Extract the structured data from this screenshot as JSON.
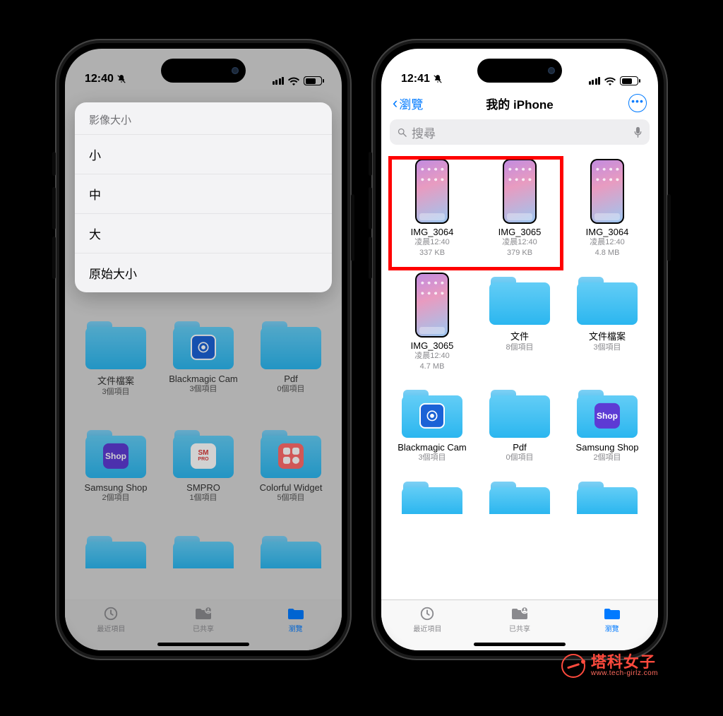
{
  "left": {
    "status": {
      "time": "12:40",
      "mute": true
    },
    "sheet": {
      "title": "影像大小",
      "options": [
        "小",
        "中",
        "大",
        "原始大小"
      ]
    },
    "grid": [
      {
        "type": "folder",
        "icon": "plain",
        "name": "文件檔案",
        "meta": "3個項目"
      },
      {
        "type": "folder",
        "icon": "cam",
        "name": "Blackmagic Cam",
        "meta": "3個項目"
      },
      {
        "type": "folder",
        "icon": "plain",
        "name": "Pdf",
        "meta": "0個項目"
      },
      {
        "type": "folder",
        "icon": "shop",
        "name": "Samsung Shop",
        "meta": "2個項目"
      },
      {
        "type": "folder",
        "icon": "smpro",
        "name": "SMPRO",
        "meta": "1個項目"
      },
      {
        "type": "folder",
        "icon": "widget",
        "name": "Colorful Widget",
        "meta": "5個項目"
      }
    ],
    "tabs": {
      "recent": "最近項目",
      "shared": "已共享",
      "browse": "瀏覽"
    }
  },
  "right": {
    "status": {
      "time": "12:41",
      "mute": true
    },
    "nav": {
      "back": "瀏覽",
      "title": "我的 iPhone"
    },
    "search": {
      "placeholder": "搜尋"
    },
    "grid": [
      {
        "type": "image",
        "name": "IMG_3064",
        "meta1": "凌晨12:40",
        "meta2": "337 KB"
      },
      {
        "type": "image",
        "name": "IMG_3065",
        "meta1": "凌晨12:40",
        "meta2": "379 KB"
      },
      {
        "type": "image",
        "name": "IMG_3064",
        "meta1": "凌晨12:40",
        "meta2": "4.8 MB"
      },
      {
        "type": "image",
        "name": "IMG_3065",
        "meta1": "凌晨12:40",
        "meta2": "4.7 MB"
      },
      {
        "type": "folder",
        "icon": "plain",
        "name": "文件",
        "meta": "8個項目"
      },
      {
        "type": "folder",
        "icon": "plain",
        "name": "文件檔案",
        "meta": "3個項目"
      },
      {
        "type": "folder",
        "icon": "cam",
        "name": "Blackmagic Cam",
        "meta": "3個項目"
      },
      {
        "type": "folder",
        "icon": "plain",
        "name": "Pdf",
        "meta": "0個項目"
      },
      {
        "type": "folder",
        "icon": "shop",
        "name": "Samsung Shop",
        "meta": "2個項目"
      }
    ],
    "tabs": {
      "recent": "最近項目",
      "shared": "已共享",
      "browse": "瀏覽"
    }
  },
  "watermark": {
    "cn": "塔科女子",
    "en": "www.tech-girlz.com"
  },
  "icons": {
    "shop_label": "Shop",
    "smpro_top": "SM",
    "smpro_bot": "PRO"
  }
}
